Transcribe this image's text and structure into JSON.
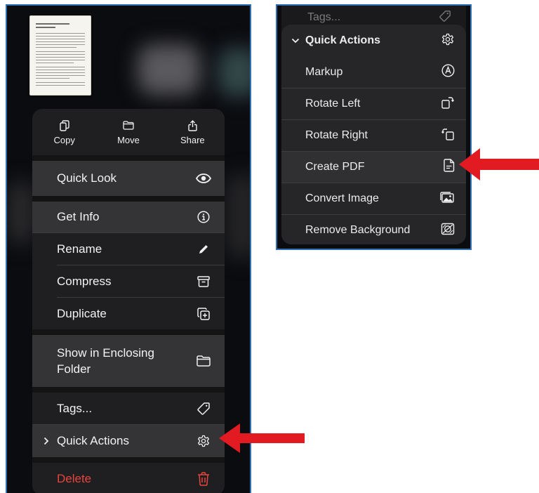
{
  "left_menu": {
    "top_actions": [
      {
        "label": "Copy",
        "icon": "copy-icon"
      },
      {
        "label": "Move",
        "icon": "folder-icon"
      },
      {
        "label": "Share",
        "icon": "share-icon"
      }
    ],
    "items": {
      "quick_look": {
        "label": "Quick Look",
        "icon": "eye-icon"
      },
      "get_info": {
        "label": "Get Info",
        "icon": "info-icon"
      },
      "rename": {
        "label": "Rename",
        "icon": "pencil-icon"
      },
      "compress": {
        "label": "Compress",
        "icon": "archive-icon"
      },
      "duplicate": {
        "label": "Duplicate",
        "icon": "duplicate-icon"
      },
      "show_enclosing_line1": {
        "label": "Show in Enclosing"
      },
      "show_enclosing_line2": {
        "label": "Folder",
        "icon": "folder-icon"
      },
      "tags": {
        "label": "Tags...",
        "icon": "tag-icon"
      },
      "quick_actions": {
        "label": "Quick Actions",
        "icon": "gear-icon"
      },
      "delete": {
        "label": "Delete",
        "icon": "trash-icon",
        "color": "#e8453c"
      }
    }
  },
  "right_menu": {
    "tags_label": "Tags...",
    "header": {
      "label": "Quick Actions",
      "icon": "gear-icon"
    },
    "items": [
      {
        "label": "Markup",
        "icon": "markup-icon"
      },
      {
        "label": "Rotate Left",
        "icon": "rotate-left-icon"
      },
      {
        "label": "Rotate Right",
        "icon": "rotate-right-icon"
      },
      {
        "label": "Create PDF",
        "icon": "pdf-icon"
      },
      {
        "label": "Convert Image",
        "icon": "photo-icon"
      },
      {
        "label": "Remove Background",
        "icon": "remove-background-icon"
      }
    ]
  },
  "annotations": {
    "arrow_color": "#e21b22"
  }
}
